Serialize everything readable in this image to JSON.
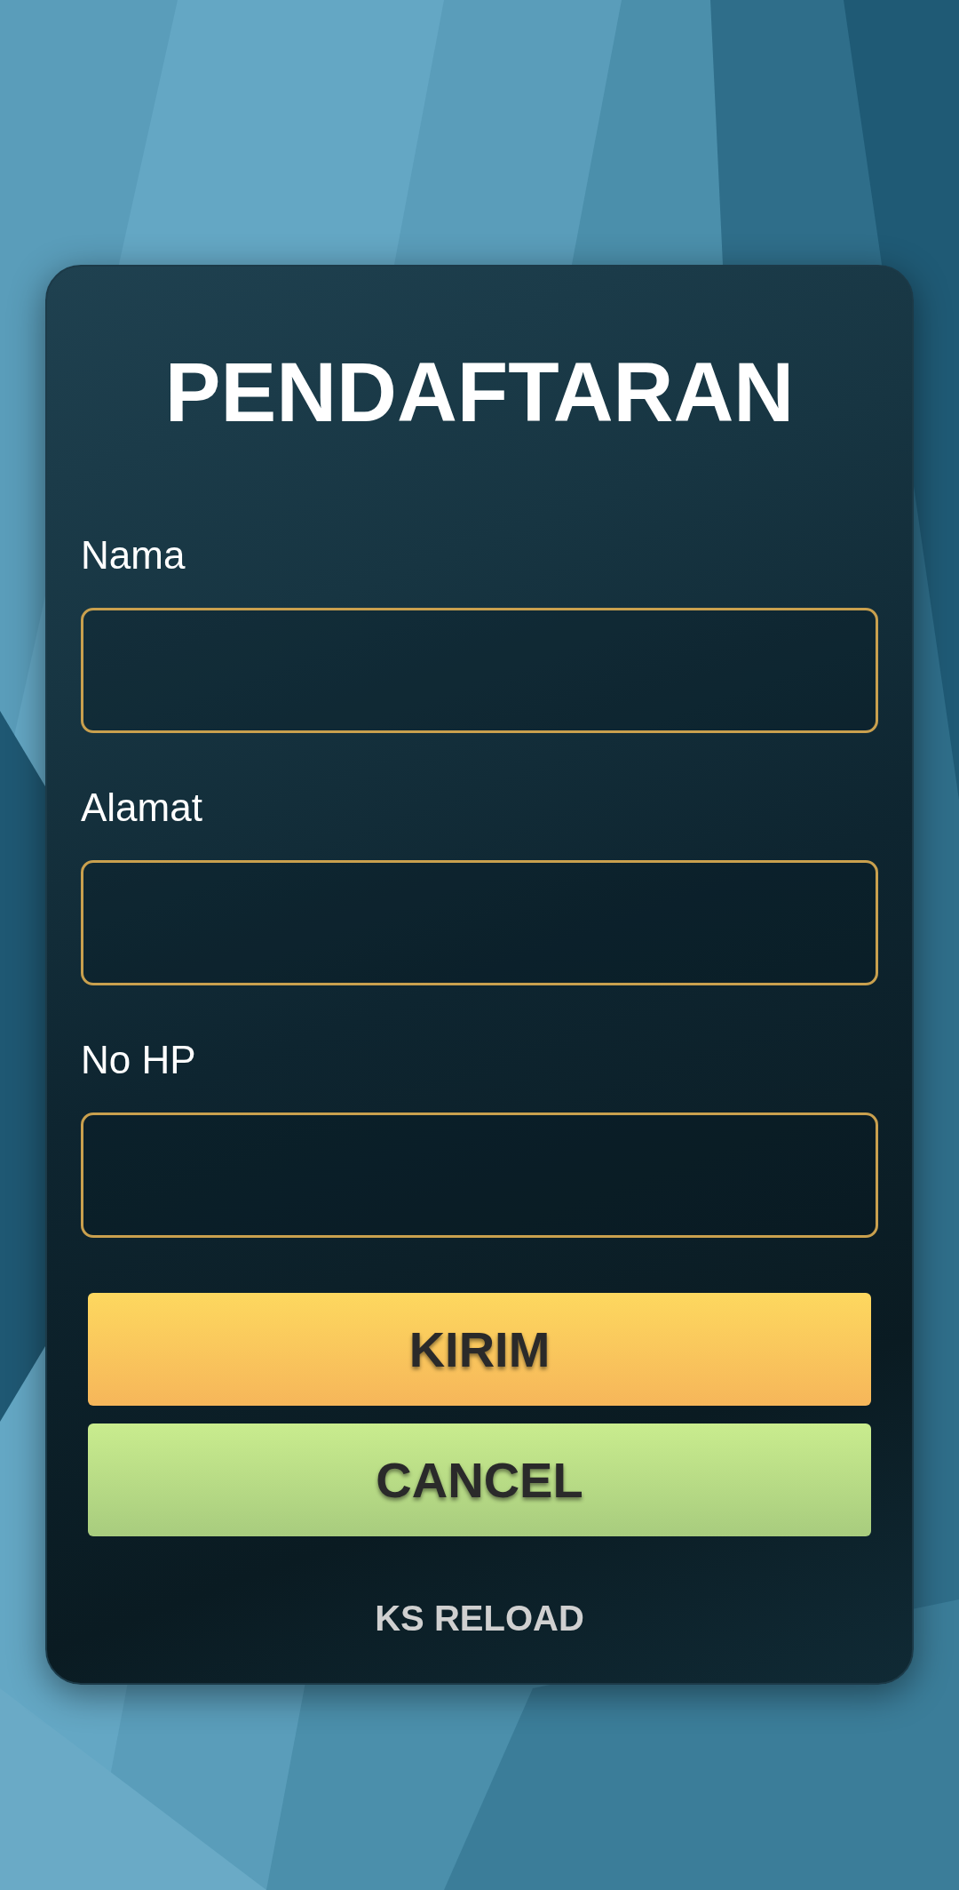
{
  "title": "PENDAFTARAN",
  "fields": [
    {
      "label": "Nama"
    },
    {
      "label": "Alamat"
    },
    {
      "label": "No HP"
    }
  ],
  "buttons": [
    {
      "label": "KIRIM",
      "kind": "submit"
    },
    {
      "label": "CANCEL",
      "kind": "cancel"
    }
  ],
  "footer": "KS RELOAD"
}
